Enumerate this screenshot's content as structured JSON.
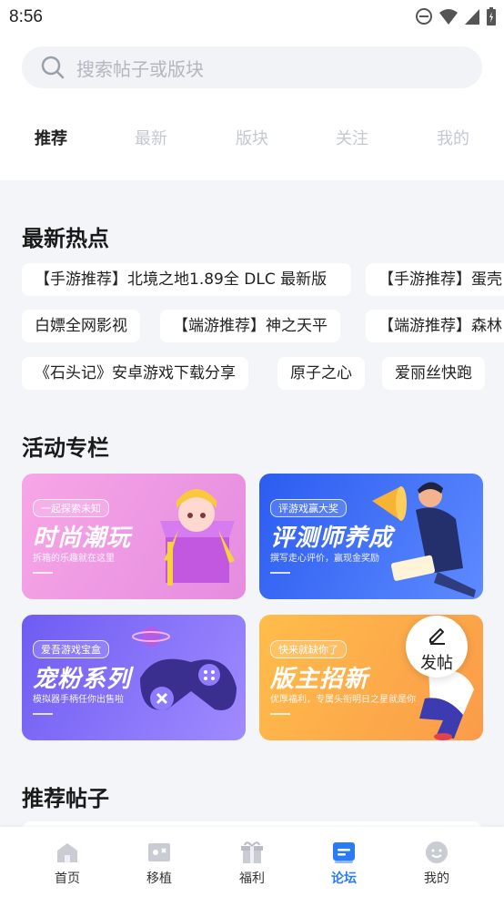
{
  "status": {
    "time": "8:56"
  },
  "search": {
    "placeholder": "搜索帖子或版块"
  },
  "tabs": [
    {
      "label": "推荐",
      "active": true
    },
    {
      "label": "最新",
      "active": false
    },
    {
      "label": "版块",
      "active": false
    },
    {
      "label": "关注",
      "active": false
    },
    {
      "label": "我的",
      "active": false
    }
  ],
  "hot": {
    "title": "最新热点",
    "items": [
      "【手游推荐】北境之地1.89全 DLC 最新版",
      "【手游推荐】蛋壳",
      "白嫖全网影视",
      "【端游推荐】神之天平",
      "【端游推荐】森林",
      "《石头记》安卓游戏下载分享",
      "原子之心",
      "爱丽丝快跑"
    ]
  },
  "activities": {
    "title": "活动专栏",
    "banners": [
      {
        "tag": "一起探索未知",
        "title": "时尚潮玩",
        "subtitle": "拆箱的乐趣就在这里",
        "color": "#f093d8"
      },
      {
        "tag": "评游戏赢大奖",
        "title": "评测师养成",
        "subtitle": "撰写走心评价，赢现金奖励",
        "color": "#2f6cf2"
      },
      {
        "tag": "爱吾游戏宝盒",
        "title": "宠粉系列",
        "subtitle": "模拟器手柄任你出售啦",
        "color": "#7a6cf5"
      },
      {
        "tag": "快来就缺你了",
        "title": "版主招新",
        "subtitle": "优厚福利，专属头衔明日之星就是你",
        "color": "#fbb04b"
      }
    ]
  },
  "recommend": {
    "title": "推荐帖子"
  },
  "fab": {
    "label": "发帖"
  },
  "nav": [
    {
      "label": "首页",
      "icon": "home-icon"
    },
    {
      "label": "移植",
      "icon": "gamepad-icon"
    },
    {
      "label": "福利",
      "icon": "gift-icon"
    },
    {
      "label": "论坛",
      "icon": "forum-icon",
      "active": true
    },
    {
      "label": "我的",
      "icon": "profile-icon"
    }
  ]
}
